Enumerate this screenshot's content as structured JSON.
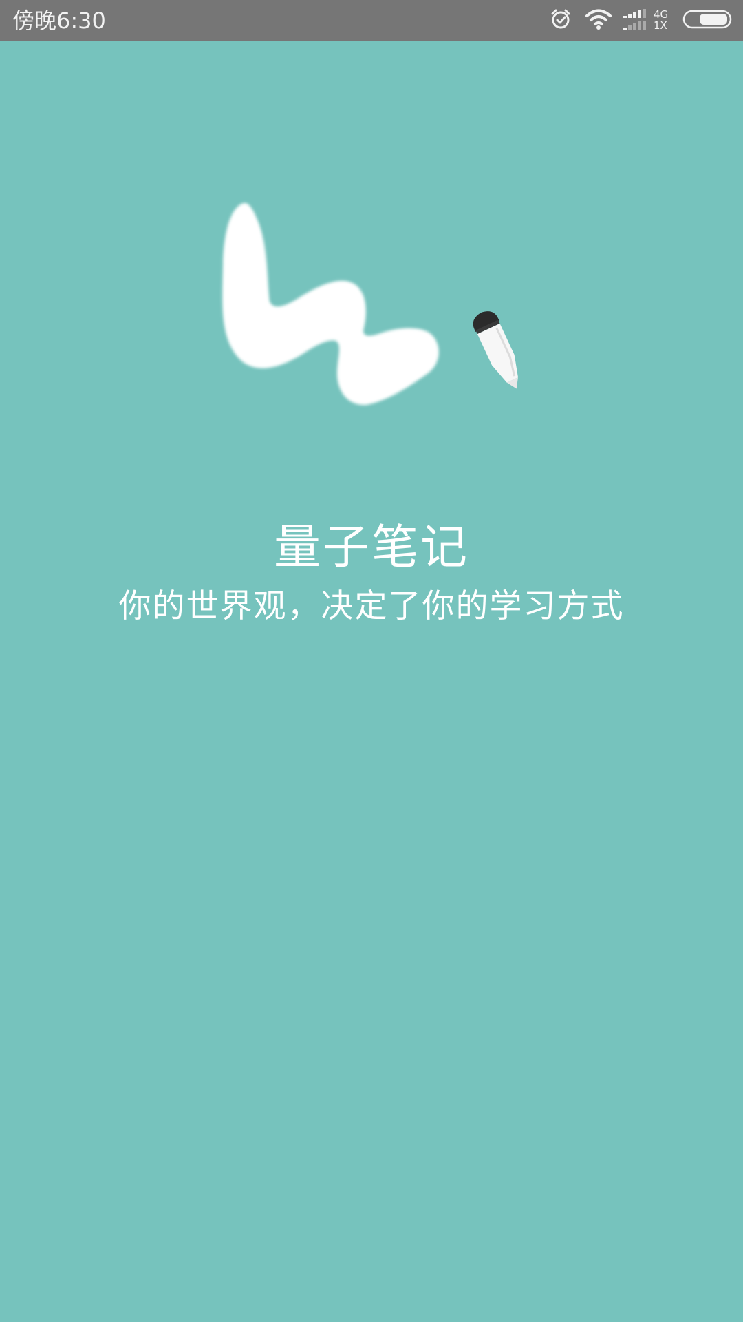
{
  "status_bar": {
    "time": "傍晚6:30",
    "network_top": "4G",
    "network_bottom": "1X",
    "icons": [
      "alarm-icon",
      "wifi-icon",
      "signal-icon",
      "battery-icon"
    ]
  },
  "splash": {
    "app_name": "量子笔记",
    "slogan": "你的世界观，决定了你的学习方式",
    "background_color": "#76c3bd",
    "text_color": "#ffffff",
    "logo": "scribble-pen-logo"
  }
}
